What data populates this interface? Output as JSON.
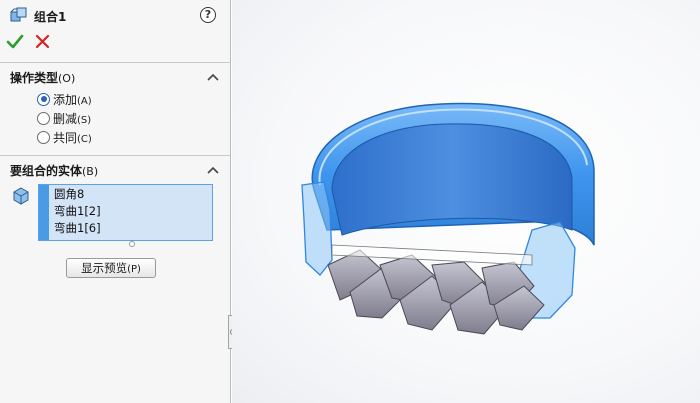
{
  "feature": {
    "title": "组合1",
    "icon": "combine-bodies-icon",
    "help_symbol": "?",
    "ok_icon": "check-icon",
    "cancel_icon": "close-icon"
  },
  "operation_type": {
    "title": "操作类型",
    "hotkey": "(O)",
    "options": [
      {
        "label": "添加",
        "hotkey": "(A)",
        "selected": true
      },
      {
        "label": "删减",
        "hotkey": "(S)",
        "selected": false
      },
      {
        "label": "共同",
        "hotkey": "(C)",
        "selected": false
      }
    ]
  },
  "bodies_to_combine": {
    "title": "要组合的实体",
    "hotkey": "(B)",
    "items": [
      "圆角8",
      "弯曲1[2]",
      "弯曲1[6]"
    ]
  },
  "preview_button": {
    "label": "显示预览",
    "hotkey": "(P)"
  },
  "colors": {
    "selection_blue": "#4a9be6",
    "ok_green": "#2e9b2e",
    "cancel_red": "#d42424",
    "ring_highlight": "#3f95ee",
    "chain_gray": "#9a98a8"
  }
}
